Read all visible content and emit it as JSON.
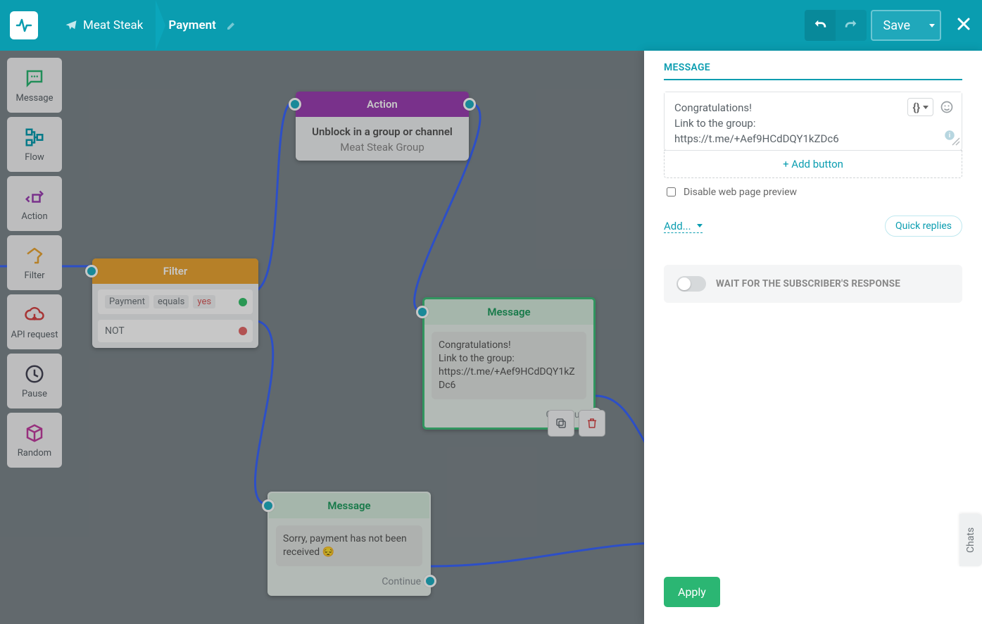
{
  "header": {
    "project": "Meat Steak",
    "flow": "Payment",
    "save": "Save"
  },
  "toolbox": {
    "message": "Message",
    "flow": "Flow",
    "action": "Action",
    "filter": "Filter",
    "api": "API request",
    "pause": "Pause",
    "random": "Random"
  },
  "nodes": {
    "action": {
      "title": "Action",
      "line1": "Unblock in a group or channel",
      "line2": "Meat Steak Group"
    },
    "filter": {
      "title": "Filter",
      "cond_field": "Payment",
      "cond_op": "equals",
      "cond_val": "yes",
      "not": "NOT"
    },
    "msg1": {
      "title": "Message",
      "body": "Congratulations!\nLink to the group:\nhttps://t.me/+Aef9HCdDQY1kZDc6",
      "continue": "Continue"
    },
    "msg2": {
      "title": "Message",
      "body": "Sorry, payment has not been received 😔",
      "continue": "Continue"
    }
  },
  "panel": {
    "title": "MESSAGE",
    "editor_text": "Congratulations!\nLink to the group:\nhttps://t.me/+Aef9HCdDQY1kZDc6",
    "add_button": "+ Add button",
    "disable_preview": "Disable web page preview",
    "add": "Add...",
    "quick_replies": "Quick replies",
    "wait": "WAIT FOR THE SUBSCRIBER'S RESPONSE",
    "apply": "Apply"
  },
  "chats_tab": "Chats"
}
